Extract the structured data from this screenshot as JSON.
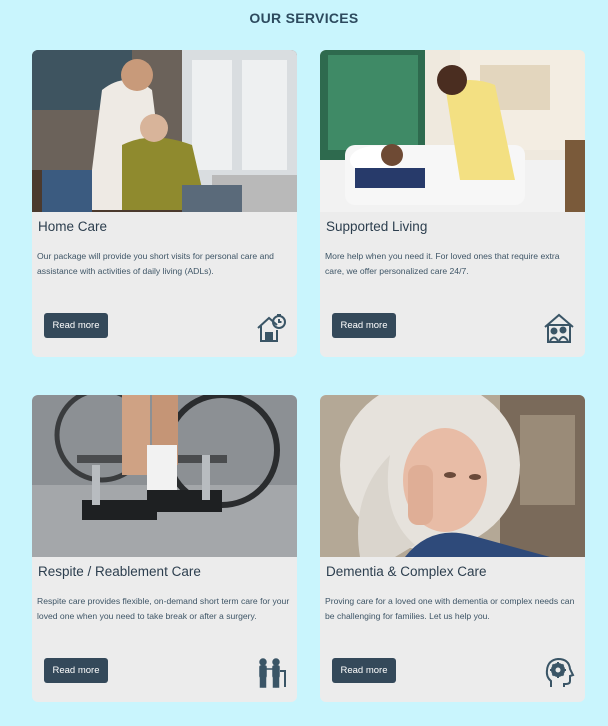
{
  "section_title": "OUR SERVICES",
  "cards": [
    {
      "title": "Home Care",
      "description": "Our package will provide you short visits for personal care and assistance with activities of daily living (ADLs).",
      "button_label": "Read more",
      "icon": "home-clock-icon"
    },
    {
      "title": "Supported Living",
      "description": "More help when you need it. For loved ones that require extra care, we offer personalized care 24/7.",
      "button_label": "Read more",
      "icon": "house-people-icon"
    },
    {
      "title": "Respite / Reablement Care",
      "description": "Respite care provides flexible, on-demand short term care for your loved one when you need to take break or after a surgery.",
      "button_label": "Read more",
      "icon": "caregiver-walker-icon"
    },
    {
      "title": "Dementia & Complex Care",
      "description": "Proving care for a loved one with dementia or complex needs can be challenging for families. Let us help you.",
      "button_label": "Read more",
      "icon": "head-brain-icon"
    }
  ],
  "colors": {
    "page_background": "#c9f5fd",
    "card_background": "#ececec",
    "button_background": "#34495a",
    "button_text": "#ffffff",
    "heading_text": "#2d4a5e",
    "icon_color": "#3a5566"
  }
}
